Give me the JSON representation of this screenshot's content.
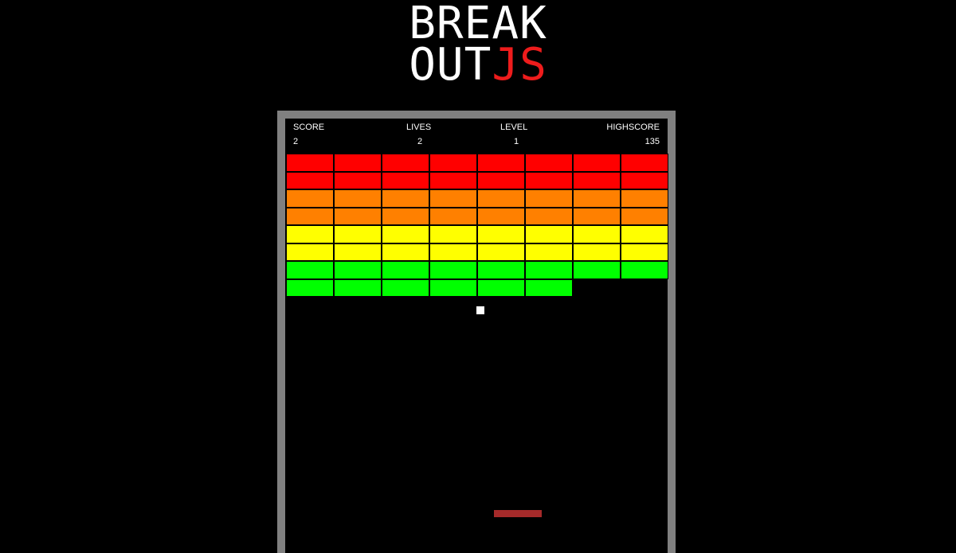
{
  "logo": {
    "line1": "BREAK",
    "line2_main": "OUT",
    "line2_accent": "JS",
    "accent_color": "#ee1c1c"
  },
  "hud": {
    "score_label": "SCORE",
    "score_value": "2",
    "lives_label": "LIVES",
    "lives_value": "2",
    "level_label": "LEVEL",
    "level_value": "1",
    "highscore_label": "HIGHSCORE",
    "highscore_value": "135"
  },
  "colors": {
    "frame": "#808080",
    "background": "#000000",
    "ball": "#ffffff",
    "paddle": "#a52a2a"
  },
  "bricks": {
    "columns": 8,
    "rows": [
      {
        "color": "#ff0000",
        "present": [
          1,
          1,
          1,
          1,
          1,
          1,
          1,
          1
        ]
      },
      {
        "color": "#ff0000",
        "present": [
          1,
          1,
          1,
          1,
          1,
          1,
          1,
          1
        ]
      },
      {
        "color": "#ff8000",
        "present": [
          1,
          1,
          1,
          1,
          1,
          1,
          1,
          1
        ]
      },
      {
        "color": "#ff8000",
        "present": [
          1,
          1,
          1,
          1,
          1,
          1,
          1,
          1
        ]
      },
      {
        "color": "#ffff00",
        "present": [
          1,
          1,
          1,
          1,
          1,
          1,
          1,
          1
        ]
      },
      {
        "color": "#ffff00",
        "present": [
          1,
          1,
          1,
          1,
          1,
          1,
          1,
          1
        ]
      },
      {
        "color": "#00ff00",
        "present": [
          1,
          1,
          1,
          1,
          1,
          1,
          1,
          1
        ]
      },
      {
        "color": "#00ff00",
        "present": [
          1,
          1,
          1,
          1,
          1,
          1,
          0,
          0
        ]
      }
    ]
  }
}
